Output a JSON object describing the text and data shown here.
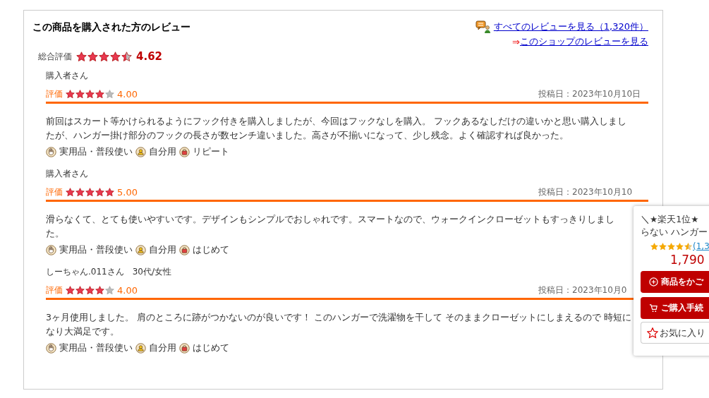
{
  "header": {
    "title": "この商品を購入された方のレビュー",
    "all_reviews_link": "すべてのレビューを見る（1,320件）",
    "shop_arrow": "⇒",
    "shop_reviews_link": "このショップのレビューを見る"
  },
  "overall": {
    "label": "総合評価",
    "stars": 4.5,
    "score": "4.62"
  },
  "reviews": [
    {
      "author": "購入者さん",
      "rating_label": "評価",
      "stars": 4,
      "score": "4.00",
      "date": "投稿日：2023年10月10日",
      "body": "前回はスカート等かけられるようにフック付きを購入しましたが、今回はフックなしを購入。 フックあるなしだけの違いかと思い購入しましたが、ハンガー掛け部分のフックの長さが数センチ違いました。高さが不揃いになって、少し残念。よく確認すれば良かった。",
      "tags": [
        {
          "kind": "hand",
          "label": "実用品・普段使い"
        },
        {
          "kind": "person",
          "label": "自分用"
        },
        {
          "kind": "bag",
          "label": "リピート"
        }
      ]
    },
    {
      "author": "購入者さん",
      "rating_label": "評価",
      "stars": 5,
      "score": "5.00",
      "date": "投稿日：2023年10月10",
      "body": "滑らなくて、とても使いやすいです。デザインもシンプルでおしゃれです。スマートなので、ウォークインクローゼットもすっきりしました。",
      "tags": [
        {
          "kind": "hand",
          "label": "実用品・普段使い"
        },
        {
          "kind": "person",
          "label": "自分用"
        },
        {
          "kind": "bag",
          "label": "はじめて"
        }
      ]
    },
    {
      "author": "しーちゃん.011さん　30代/女性",
      "rating_label": "評価",
      "stars": 4,
      "score": "4.00",
      "date": "投稿日：2023年10月0",
      "body": "3ヶ月使用しました。 肩のところに跡がつかないのが良いです！ このハンガーで洗濯物を干して そのままクローゼットにしまえるので 時短になり大満足です。",
      "tags": [
        {
          "kind": "hand",
          "label": "実用品・普段使い"
        },
        {
          "kind": "person",
          "label": "自分用"
        },
        {
          "kind": "bag",
          "label": "はじめて"
        }
      ]
    }
  ],
  "popup": {
    "title_line_1": "＼★楽天1位★",
    "title_line_2": "らない ハンガー",
    "stars": 4.5,
    "review_count": "(1,3",
    "price": "1,790",
    "add_to_cart": "商品をかご",
    "checkout": "ご購入手続",
    "favorite": "お気に入り"
  }
}
